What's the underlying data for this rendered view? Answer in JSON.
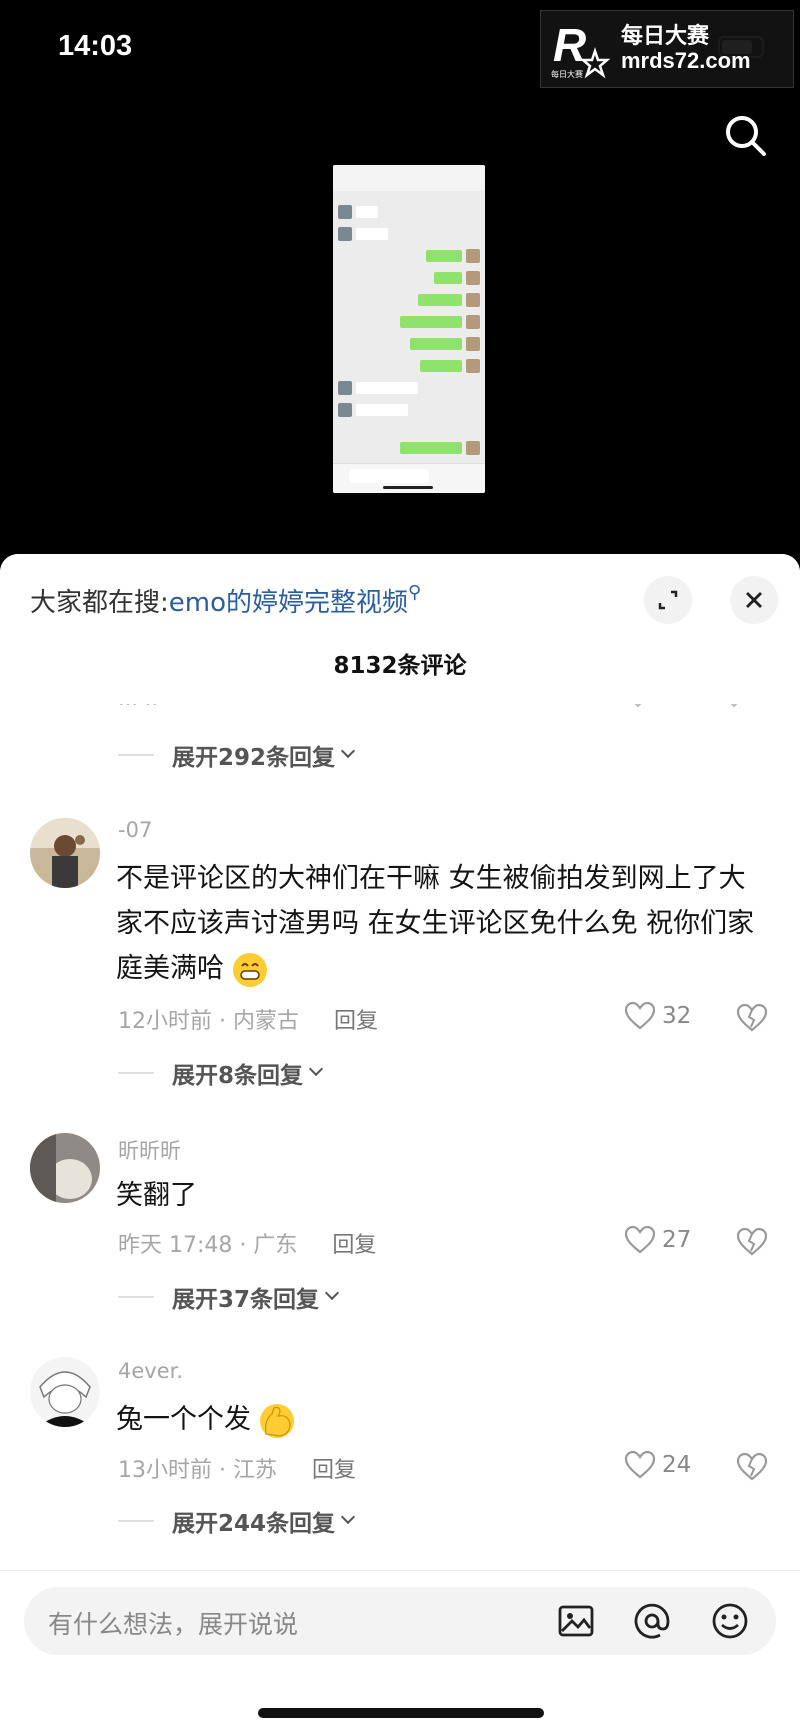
{
  "status": {
    "time": "14:03"
  },
  "watermark": {
    "cn": "每日大赛",
    "url": "mrds72.com",
    "logo_text": "R"
  },
  "top_icons": {
    "search": "search-icon"
  },
  "sheet": {
    "hot_search_label": "大家都在搜:",
    "hot_search_keyword": "emo的婷婷完整视频",
    "comment_count": "8132条评论"
  },
  "partial": {
    "replies": "展开292条回复"
  },
  "comments": [
    {
      "username": "-07",
      "text": "不是评论区的大神们在干嘛 女生被偷拍发到网上了大家不应该声讨渣男吗 在女生评论区免什么免 祝你们家庭美满哈",
      "emoji": "grin-emoji",
      "time_location": "12小时前 · 内蒙古",
      "reply_label": "回复",
      "likes": "32",
      "replies": "展开8条回复"
    },
    {
      "username": "昕昕昕",
      "text": "笑翻了",
      "time_location": "昨天 17:48 · 广东",
      "reply_label": "回复",
      "likes": "27",
      "replies": "展开37条回复"
    },
    {
      "username": "4ever.",
      "text": "兔一个个发",
      "emoji": "flex-emoji",
      "time_location": "13小时前 · 江苏",
      "reply_label": "回复",
      "likes": "24",
      "replies": "展开244条回复"
    }
  ],
  "input": {
    "placeholder": "有什么想法，展开说说"
  },
  "colors": {
    "accent_link": "#2b5e9e",
    "chat_green": "#8fe36d"
  }
}
